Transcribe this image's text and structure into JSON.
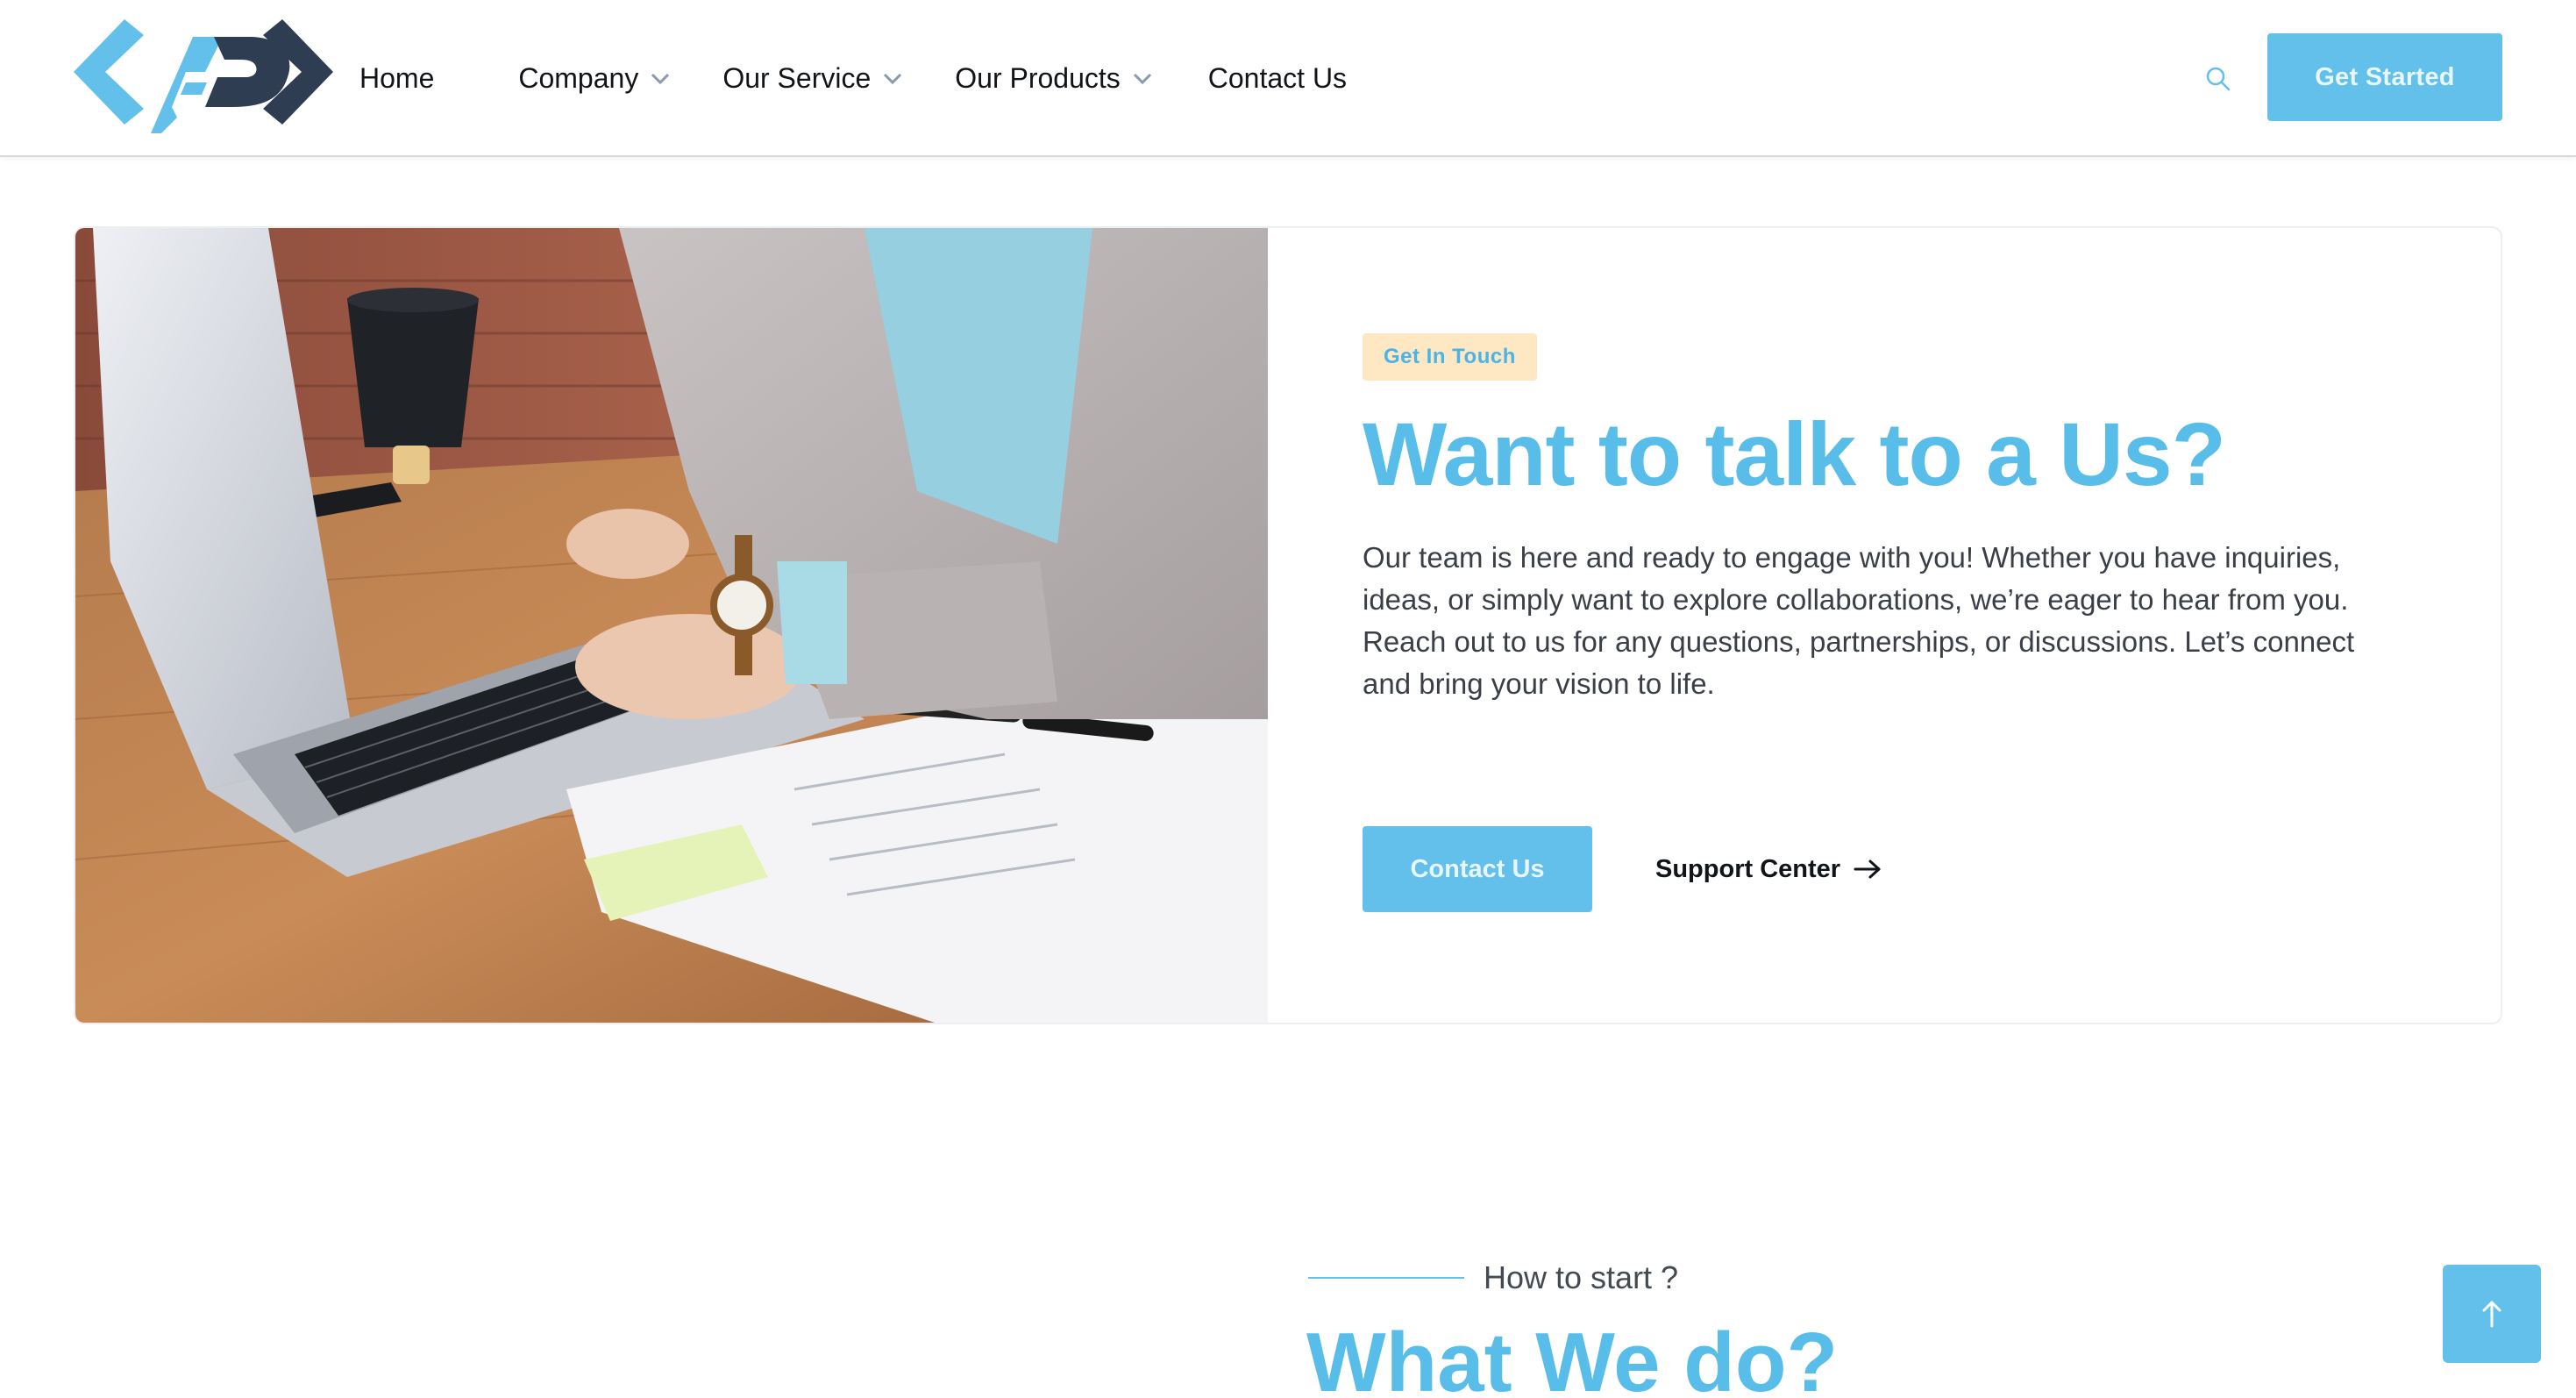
{
  "header": {
    "nav": [
      {
        "label": "Home",
        "has_dropdown": false
      },
      {
        "label": "Company",
        "has_dropdown": true
      },
      {
        "label": "Our Service",
        "has_dropdown": true
      },
      {
        "label": "Our Products",
        "has_dropdown": true
      },
      {
        "label": "Contact Us",
        "has_dropdown": false
      }
    ],
    "search_icon": "search-icon",
    "cta_label": "Get Started"
  },
  "contact_card": {
    "badge": "Get In Touch",
    "title": "Want to talk to a Us?",
    "description": "Our team is here and ready to engage with you! Whether you have inquiries, ideas, or simply want to explore collaborations, we’re eager to hear from you. Reach out to us for any questions, partnerships, or discussions. Let’s connect and bring your vision to life.",
    "primary_button": "Contact Us",
    "secondary_link": "Support Center"
  },
  "how_section": {
    "kicker": "How to start ?",
    "title": "What We do?"
  },
  "colors": {
    "accent": "#62c0eb",
    "accent_text": "#58bde8",
    "badge_bg": "#fde8c3",
    "logo_dark": "#2e3d52"
  }
}
